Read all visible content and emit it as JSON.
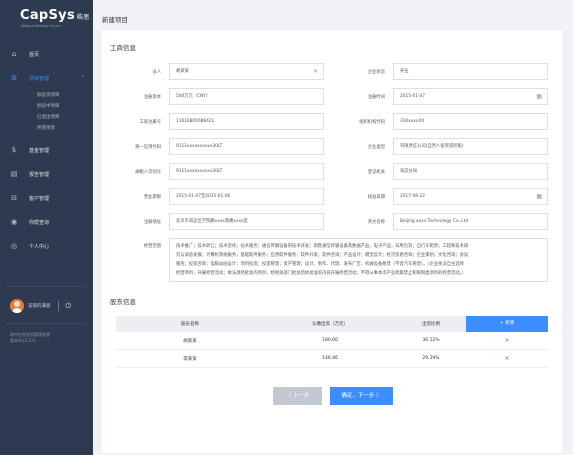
{
  "logo": {
    "main": "CapSys",
    "cn": "皓思",
    "tagline": "Always thinking of you"
  },
  "sidebar": {
    "items": [
      {
        "label": "首页",
        "icon": "home-icon",
        "glyph": "⌂"
      },
      {
        "label": "项目管理",
        "icon": "project-icon",
        "glyph": "⊞",
        "active": true
      },
      {
        "label": "基金管理",
        "icon": "fund-icon",
        "glyph": "$"
      },
      {
        "label": "报告管理",
        "icon": "report-icon",
        "glyph": "▤"
      },
      {
        "label": "客户管理",
        "icon": "customer-icon",
        "glyph": "⊟"
      },
      {
        "label": "你帮查询",
        "icon": "query-icon",
        "glyph": "◉"
      },
      {
        "label": "个人中心",
        "icon": "user-center-icon",
        "glyph": "◎"
      }
    ],
    "sub_items": [
      "拟投资项目",
      "拟投中项目",
      "已退出项目",
      "终管项目"
    ],
    "user_name": "美丽的满意",
    "sys_info": [
      "易中信息投资管理系统",
      "版本号V1.0.0"
    ]
  },
  "page_title": "新建项目",
  "section1_title": "工商信息",
  "form": {
    "left": [
      {
        "label": "法人",
        "value": "胡某某",
        "trail": "✕"
      },
      {
        "label": "注册资本",
        "value": "500万元（CNY）"
      },
      {
        "label": "工商注册号",
        "value": "11010800088421"
      },
      {
        "label": "统一信用代码",
        "value": "9111xxxxxxxxxx30LT"
      },
      {
        "label": "纳税人识别号",
        "value": "9111xxxxxxxxxx30LT"
      },
      {
        "label": "营业期限",
        "value": "2015-01-07至2035-01-06"
      },
      {
        "label": "注册地址",
        "value": "北京市海淀区学院路xxxx南楼xxxx室"
      }
    ],
    "right": [
      {
        "label": "企业状态",
        "value": "开业"
      },
      {
        "label": "注册时间",
        "value": "2015-01-07",
        "trail": "▦"
      },
      {
        "label": "组织机构代码",
        "value": "330xxxxXX"
      },
      {
        "label": "企业类型",
        "value": "有限责任公司(自然人投资或控股)"
      },
      {
        "label": "登记机关",
        "value": "海淀分局"
      },
      {
        "label": "核准日期",
        "value": "2017-08-22",
        "trail": "▦"
      },
      {
        "label": "英文名称",
        "value": "Beijing xxxx Technology Co.,Ltd"
      }
    ],
    "scope_label": "经营范围",
    "scope_lines": [
      "技术推广；技术转让；技术咨询；技术服务；通信传输设备的技术开发；销售通信传输设备及数据产品，电子产品；日用百货；自行车租赁；工程和技术研",
      "究与试验发展；计算机系统服务；基础软件服务；应用软件服务；软件开发；软件咨询；产品设计；模型设计；经济贸易咨询；企业策划；文化咨询；会议",
      "服务；投资咨询；电脑动画设计；项目投资；投资管理；资产管理；设计、制作、代理、发布广告；机械设备租赁（不含汽车租赁）。（企业依法自主选择",
      "经营项目，开展经营活动；依法须经批准的项目，经相关部门批准后依批准的内容开展经营活动；不得从事本市产业政策禁止和限制类项目的经营活动。）"
    ]
  },
  "section2_title": "股东信息",
  "table": {
    "headers": [
      "股东名称",
      "认缴出资（万元）",
      "出资比例"
    ],
    "add_label": "+ 新增",
    "rows": [
      {
        "name": "胡某某",
        "amount": "180.60",
        "ratio": "36.12%"
      },
      {
        "name": "李某某",
        "amount": "146.46",
        "ratio": "29.29%"
      }
    ]
  },
  "buttons": {
    "prev": "〈 上一步",
    "next": "确定，下一步 〉"
  },
  "colors": {
    "sidebar": "#2e3a4f",
    "accent": "#3c8dff",
    "delete": "#ea5b5b"
  }
}
